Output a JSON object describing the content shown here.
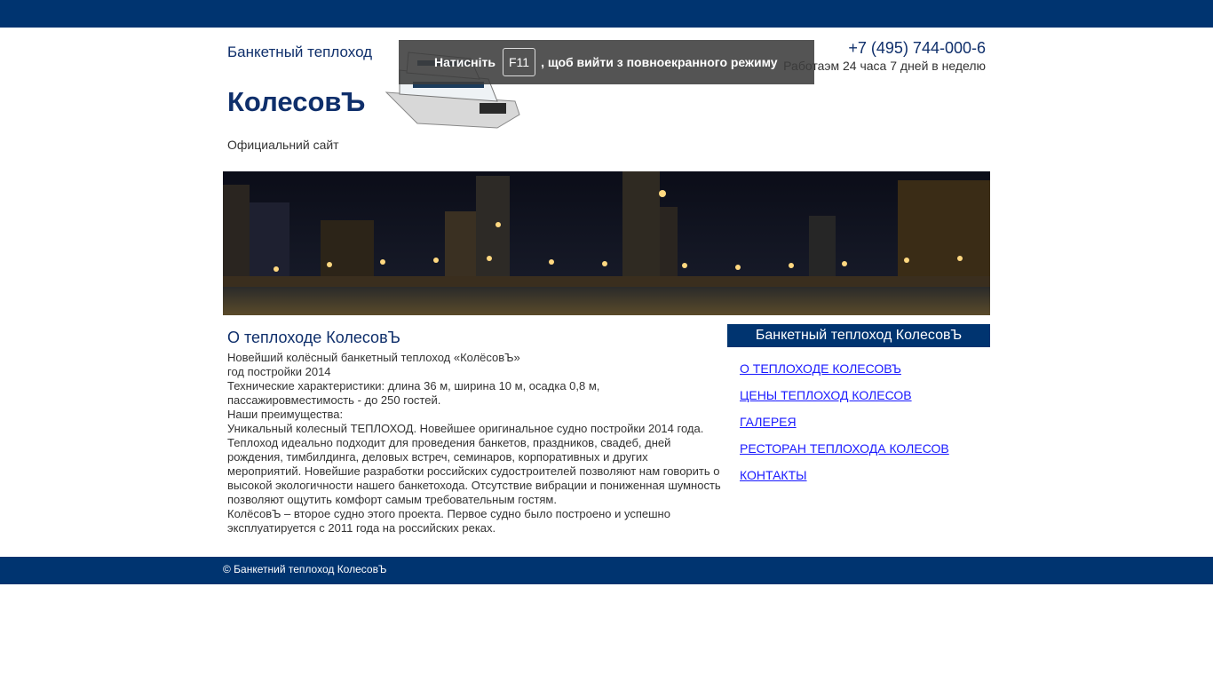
{
  "header": {
    "subtitle": "Банкетный теплоход",
    "title": "КолесовЪ",
    "tagline": "Официальний сайт",
    "phone": "+7 (495) 744-000-6",
    "hours": "Работаэм 24 часа 7 дней в неделю"
  },
  "fullscreen_notice": {
    "prefix": "Натисніть",
    "key": "F11",
    "suffix": ", щоб вийти з повноекранного режиму"
  },
  "main": {
    "title": "О теплоходе КолесовЪ",
    "paragraphs": [
      "Новейший колёсный банкетный теплоход «КолёсовЪ»",
      "год постройки 2014",
      "Технические характеристики: длина 36 м, ширина 10 м, осадка 0,8 м, пассажировместимость - до 250 гостей.",
      "Наши преимущества:",
      "Уникальный колесный ТЕПЛОХОД. Новейшее оригинальное судно постройки 2014 года. Теплоход идеально подходит для проведения банкетов, праздников, свадеб, дней рождения, тимбилдинга, деловых встреч, семинаров, корпоративных и других мероприятий. Новейшие разработки российских судостроителей позволяют нам говорить о высокой экологичности нашего банкетохода. Отсутствие вибрации и пониженная шумность позволяют ощутить комфорт самым требовательным гостям.",
      "КолёсовЪ – второе судно этого проекта. Первое судно было построено и успешно эксплуатируется с 2011 года на российских реках."
    ]
  },
  "sidebar": {
    "heading": "Банкетный теплоход КолесовЪ",
    "links": [
      "О ТЕПЛОХОДЕ КОЛЕСОВЪ",
      "ЦЕНЫ ТЕПЛОХОД КОЛЕСОВ",
      "ГАЛЕРЕЯ",
      "РЕСТОРАН ТЕПЛОХОДА КОЛЕСОВ",
      "КОНТАКТЫ"
    ]
  },
  "footer": {
    "copyright": "© Банкетний теплоход КолесовЪ"
  },
  "colors": {
    "brand": "#003470",
    "link": "#1a1aff"
  }
}
